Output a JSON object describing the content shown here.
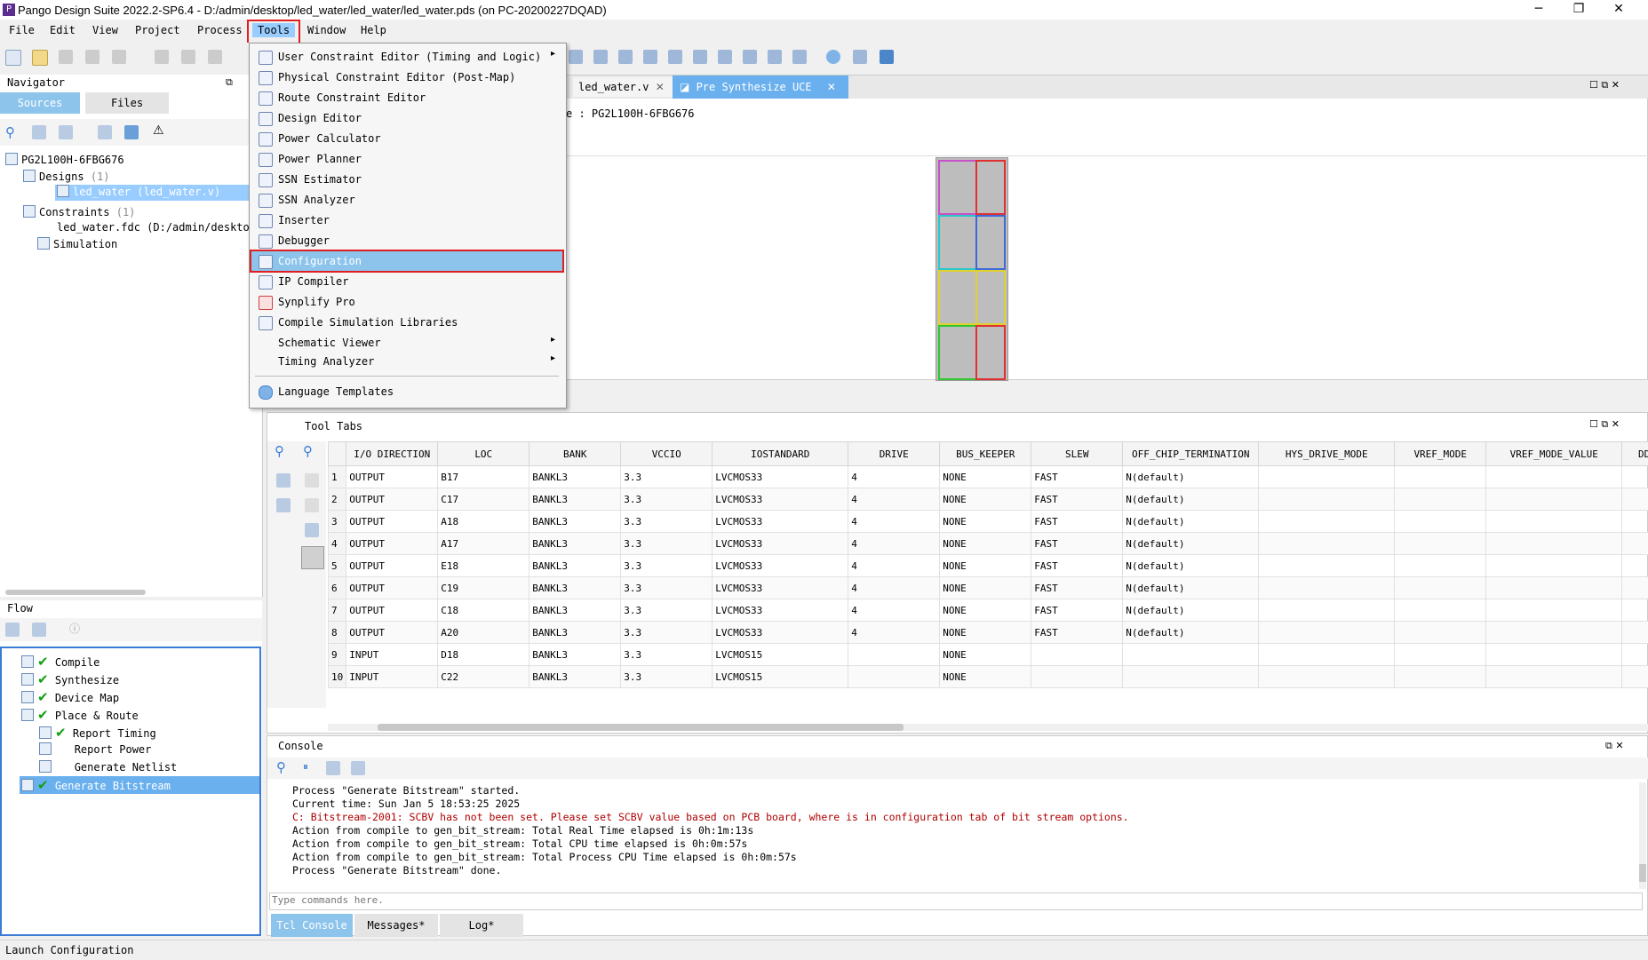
{
  "window": {
    "title": "Pango Design Suite 2022.2-SP6.4 - D:/admin/desktop/led_water/led_water/led_water.pds (on PC-20200227DQAD)",
    "controls": [
      "─",
      "❐",
      "✕"
    ]
  },
  "menubar": [
    "File",
    "Edit",
    "View",
    "Project",
    "Process",
    "Tools",
    "Window",
    "Help"
  ],
  "navigator": {
    "title": "Navigator",
    "tabs": [
      "Sources",
      "Files"
    ],
    "tree": {
      "root": "PG2L100H-6FBG676",
      "designs": "Designs",
      "designs_count": "(1)",
      "design_item": "led_water (led_water.v)",
      "constraints": "Constraints",
      "constraints_count": "(1)",
      "constraint_item": "led_water.fdc (D:/admin/desktop",
      "simulation": "Simulation"
    }
  },
  "flow": {
    "title": "Flow",
    "items": [
      "Compile",
      "Synthesize",
      "Device Map",
      "Place & Route",
      "Report Timing",
      "Report Power",
      "Generate Netlist",
      "Generate Bitstream"
    ]
  },
  "editor": {
    "tabs": [
      "led_water.v",
      "Pre Synthesize UCE"
    ],
    "device_label": "e : PG2L100H-6FBG676"
  },
  "tools_menu": {
    "items": [
      {
        "label": "User Constraint Editor (Timing and Logic)",
        "submenu": true
      },
      {
        "label": "Physical Constraint Editor (Post-Map)"
      },
      {
        "label": "Route Constraint Editor"
      },
      {
        "label": "Design Editor"
      },
      {
        "label": "Power Calculator"
      },
      {
        "label": "Power Planner"
      },
      {
        "label": "SSN Estimator"
      },
      {
        "label": "SSN Analyzer"
      },
      {
        "label": "Inserter"
      },
      {
        "label": "Debugger"
      },
      {
        "label": "Configuration",
        "highlighted": true
      },
      {
        "label": "IP Compiler"
      },
      {
        "label": "Synplify Pro"
      },
      {
        "label": "Compile Simulation Libraries"
      },
      {
        "label": "Schematic Viewer",
        "submenu": true
      },
      {
        "label": "Timing Analyzer",
        "submenu": true
      },
      {
        "label": "Language Templates"
      }
    ]
  },
  "tool_tabs": {
    "title": "Tool Tabs",
    "columns": [
      "I/O DIRECTION",
      "LOC",
      "BANK",
      "VCCIO",
      "IOSTANDARD",
      "DRIVE",
      "BUS_KEEPER",
      "SLEW",
      "OFF_CHIP_TERMINATION",
      "HYS_DRIVE_MODE",
      "VREF_MODE",
      "VREF_MODE_VALUE",
      "DDR_"
    ],
    "rows": [
      [
        "1",
        "OUTPUT",
        "B17",
        "BANKL3",
        "3.3",
        "LVCMOS33",
        "4",
        "NONE",
        "FAST",
        "N(default)",
        "",
        "",
        "",
        ""
      ],
      [
        "2",
        "OUTPUT",
        "C17",
        "BANKL3",
        "3.3",
        "LVCMOS33",
        "4",
        "NONE",
        "FAST",
        "N(default)",
        "",
        "",
        "",
        ""
      ],
      [
        "3",
        "OUTPUT",
        "A18",
        "BANKL3",
        "3.3",
        "LVCMOS33",
        "4",
        "NONE",
        "FAST",
        "N(default)",
        "",
        "",
        "",
        ""
      ],
      [
        "4",
        "OUTPUT",
        "A17",
        "BANKL3",
        "3.3",
        "LVCMOS33",
        "4",
        "NONE",
        "FAST",
        "N(default)",
        "",
        "",
        "",
        ""
      ],
      [
        "5",
        "OUTPUT",
        "E18",
        "BANKL3",
        "3.3",
        "LVCMOS33",
        "4",
        "NONE",
        "FAST",
        "N(default)",
        "",
        "",
        "",
        ""
      ],
      [
        "6",
        "OUTPUT",
        "C19",
        "BANKL3",
        "3.3",
        "LVCMOS33",
        "4",
        "NONE",
        "FAST",
        "N(default)",
        "",
        "",
        "",
        ""
      ],
      [
        "7",
        "OUTPUT",
        "C18",
        "BANKL3",
        "3.3",
        "LVCMOS33",
        "4",
        "NONE",
        "FAST",
        "N(default)",
        "",
        "",
        "",
        ""
      ],
      [
        "8",
        "OUTPUT",
        "A20",
        "BANKL3",
        "3.3",
        "LVCMOS33",
        "4",
        "NONE",
        "FAST",
        "N(default)",
        "",
        "",
        "",
        ""
      ],
      [
        "9",
        "INPUT",
        "D18",
        "BANKL3",
        "3.3",
        "LVCMOS15",
        "",
        "NONE",
        "",
        "",
        "",
        "",
        "",
        ""
      ],
      [
        "10",
        "INPUT",
        "C22",
        "BANKL3",
        "3.3",
        "LVCMOS15",
        "",
        "NONE",
        "",
        "",
        "",
        "",
        "",
        ""
      ]
    ]
  },
  "console": {
    "title": "Console",
    "lines": [
      {
        "text": "Process \"Generate Bitstream\" started.",
        "color": "#000000"
      },
      {
        "text": "Current time: Sun Jan  5 18:53:25 2025",
        "color": "#000000"
      },
      {
        "text": "C: Bitstream-2001: SCBV has not been set. Please set SCBV value based on PCB board, where is in configuration tab of bit stream options.",
        "color": "#b00000"
      },
      {
        "text": "Action from compile to gen_bit_stream: Total Real Time elapsed is 0h:1m:13s",
        "color": "#000000"
      },
      {
        "text": "Action from compile to gen_bit_stream: Total CPU time elapsed is 0h:0m:57s",
        "color": "#000000"
      },
      {
        "text": "Action from compile to gen_bit_stream: Total Process CPU Time elapsed is 0h:0m:57s",
        "color": "#000000"
      },
      {
        "text": "Process \"Generate Bitstream\" done.",
        "color": "#000000"
      }
    ],
    "input_placeholder": "Type commands here.",
    "tabs": [
      "Tcl Console",
      "Messages*",
      "Log*"
    ]
  },
  "statusbar": {
    "text": "Launch Configuration"
  },
  "colors": {
    "accent": "#8cc4ec",
    "selection": "#99ccff",
    "highlight_box": "#e02020",
    "check": "#10a010"
  }
}
